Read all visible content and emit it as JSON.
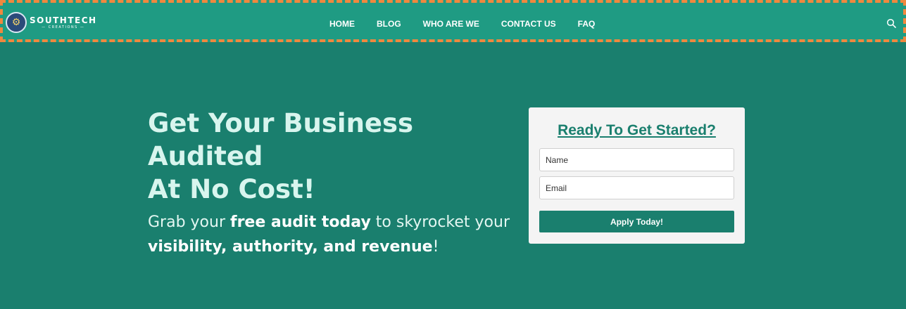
{
  "brand": {
    "name": "SOUTHTECH",
    "tagline": "— CREATIONS —",
    "icon": "circuit-logo-icon"
  },
  "nav": {
    "items": [
      {
        "label": "HOME"
      },
      {
        "label": "BLOG"
      },
      {
        "label": "WHO ARE WE"
      },
      {
        "label": "CONTACT US"
      },
      {
        "label": "FAQ"
      }
    ],
    "search_icon": "search-icon"
  },
  "hero": {
    "title_line1": "Get Your Business Audited",
    "title_line2": "At No Cost!",
    "sub_part1": "Grab your ",
    "sub_bold1": "free audit today",
    "sub_part2": " to skyrocket your ",
    "sub_bold2": "visibility, authority, and revenue",
    "sub_part3": "!"
  },
  "form": {
    "title": "Ready To Get Started?",
    "name_placeholder": "Name",
    "email_placeholder": "Email",
    "submit_label": "Apply Today!"
  },
  "colors": {
    "background": "#1a7f6e",
    "header": "#1f9b83",
    "header_outline": "#f0883e",
    "card": "#f4f4f4",
    "accent": "#1a7f6e"
  }
}
